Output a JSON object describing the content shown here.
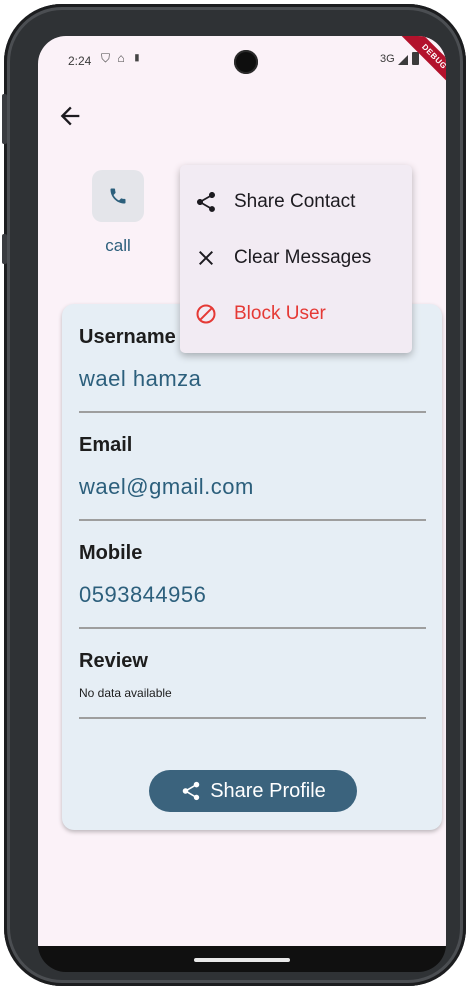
{
  "status_bar": {
    "time": "2:24",
    "icons": "⛉ ⌂ ▮",
    "network": "3G",
    "debug_banner": "DEBUG"
  },
  "header": {
    "back_icon": "arrow-left-icon"
  },
  "actions": {
    "call_label": "call",
    "call_icon": "phone-icon"
  },
  "popup_menu": {
    "items": [
      {
        "label": "Share Contact",
        "icon": "share-icon",
        "color": "#1d1b20"
      },
      {
        "label": "Clear Messages",
        "icon": "close-icon",
        "color": "#1d1b20"
      },
      {
        "label": "Block User",
        "icon": "block-icon",
        "color": "#e53935"
      }
    ]
  },
  "profile": {
    "username_label": "Username",
    "username_value": "wael hamza",
    "email_label": "Email",
    "email_value": "wael@gmail.com",
    "mobile_label": "Mobile",
    "mobile_value": "0593844956",
    "review_label": "Review",
    "review_value": "No data available",
    "share_button": "Share Profile"
  },
  "colors": {
    "accent": "#2c5f7c",
    "button_bg": "#3b637d",
    "card_bg": "#e6eef5",
    "app_bg": "#fbf2f8",
    "danger": "#e53935"
  }
}
